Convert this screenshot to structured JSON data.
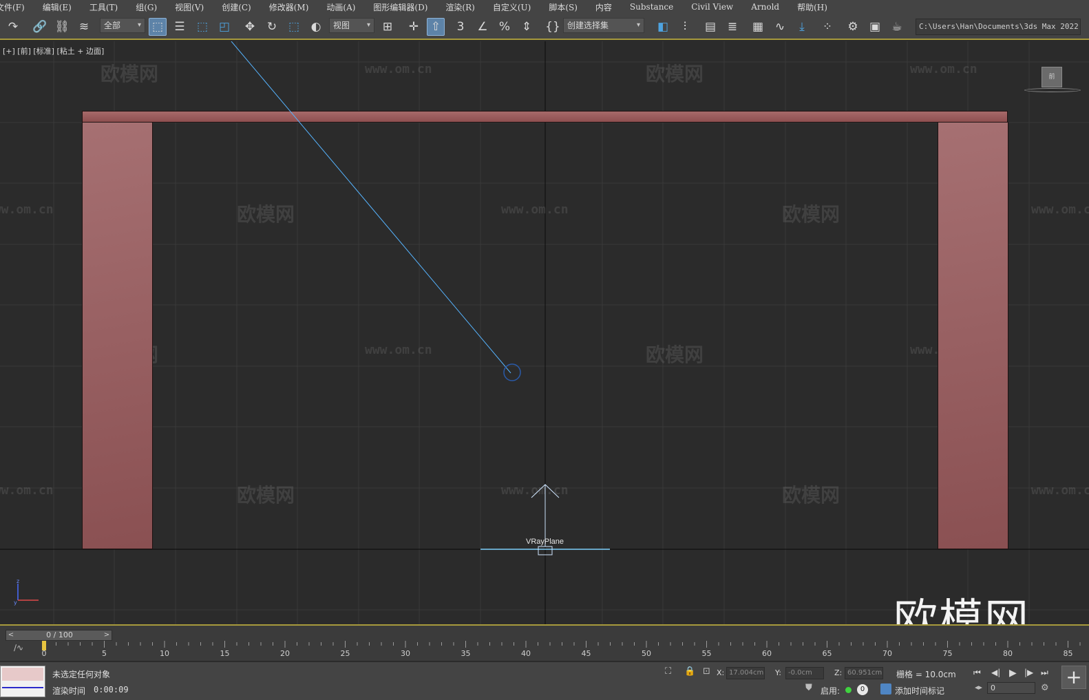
{
  "menu": {
    "items": [
      "文件(F)",
      "编辑(E)",
      "工具(T)",
      "组(G)",
      "视图(V)",
      "创建(C)",
      "修改器(M)",
      "动画(A)",
      "图形编辑器(D)",
      "渲染(R)",
      "自定义(U)",
      "脚本(S)",
      "内容",
      "Substance",
      "Civil View",
      "Arnold",
      "帮助(H)"
    ]
  },
  "toolbar": {
    "filter_dropdown": "全部",
    "coord_dropdown": "视图",
    "selection_set": "创建选择集",
    "project_path": "C:\\Users\\Han\\Documents\\3ds Max 2022",
    "icons": {
      "redo": "redo-icon",
      "link": "link-icon",
      "unlink": "unlink-icon",
      "bind_space_warp": "bind-space-warp-icon",
      "select": "select-object-icon",
      "select_by_name": "select-by-name-icon",
      "rect_region": "rect-selection-icon",
      "window_crossing": "window-crossing-icon",
      "move": "move-icon",
      "rotate": "rotate-icon",
      "scale": "scale-icon",
      "placement": "placement-icon",
      "pivot": "pivot-icon",
      "manipulate": "manipulate-icon",
      "keyboard_override": "keyboard-shortcut-override-icon",
      "snaps": "snaps-toggle-icon",
      "angle_snap": "angle-snap-icon",
      "percent_snap": "percent-snap-icon",
      "spinner_snap": "spinner-snap-icon",
      "edit_named_sets": "edit-named-selection-icon",
      "mirror": "mirror-icon",
      "align": "align-icon",
      "scene_explorer": "scene-explorer-icon",
      "layer_explorer": "layer-explorer-icon",
      "ribbon": "ribbon-toggle-icon",
      "curve_editor": "curve-editor-icon",
      "dope_sheet": "dope-sheet-icon",
      "schematic": "schematic-view-icon",
      "render_setup": "render-setup-icon",
      "rendered_frame": "rendered-frame-window-icon",
      "render": "render-teapot-icon"
    }
  },
  "viewport": {
    "label": "[+] [前] [标准] [粘土 + 边面]",
    "object_label": "VRayPlane",
    "viewcube_label": "前",
    "watermark_text": "欧模网",
    "watermark_url": "www.om.cn",
    "big_logo": "欧模网",
    "axis_tripod": "axis-tripod-icon",
    "colors": {
      "background": "#2b2b2b",
      "object_fill": "#9b5f61",
      "light_line": "#56b4ff"
    }
  },
  "timeline": {
    "slider_text": "0 / 100",
    "ticks": [
      "0",
      "5",
      "10",
      "15",
      "20",
      "25",
      "30",
      "35",
      "40",
      "45",
      "50",
      "55",
      "60",
      "65",
      "70",
      "75",
      "80",
      "85"
    ],
    "prev_arrow": "<",
    "next_arrow": ">"
  },
  "status": {
    "message": "未选定任何对象",
    "render_time_label": "渲染时间",
    "render_time_value": "0:00:09",
    "x_label": "X:",
    "x_value": "17.004cm",
    "y_label": "Y:",
    "y_value": "-0.0cm",
    "z_label": "Z:",
    "z_value": "60.951cm",
    "grid": "栅格 = 10.0cm",
    "enable_label": "启用:",
    "enable_count": "0",
    "add_time_tag": "添加时间标记",
    "current_frame": "0",
    "plus": "+"
  }
}
